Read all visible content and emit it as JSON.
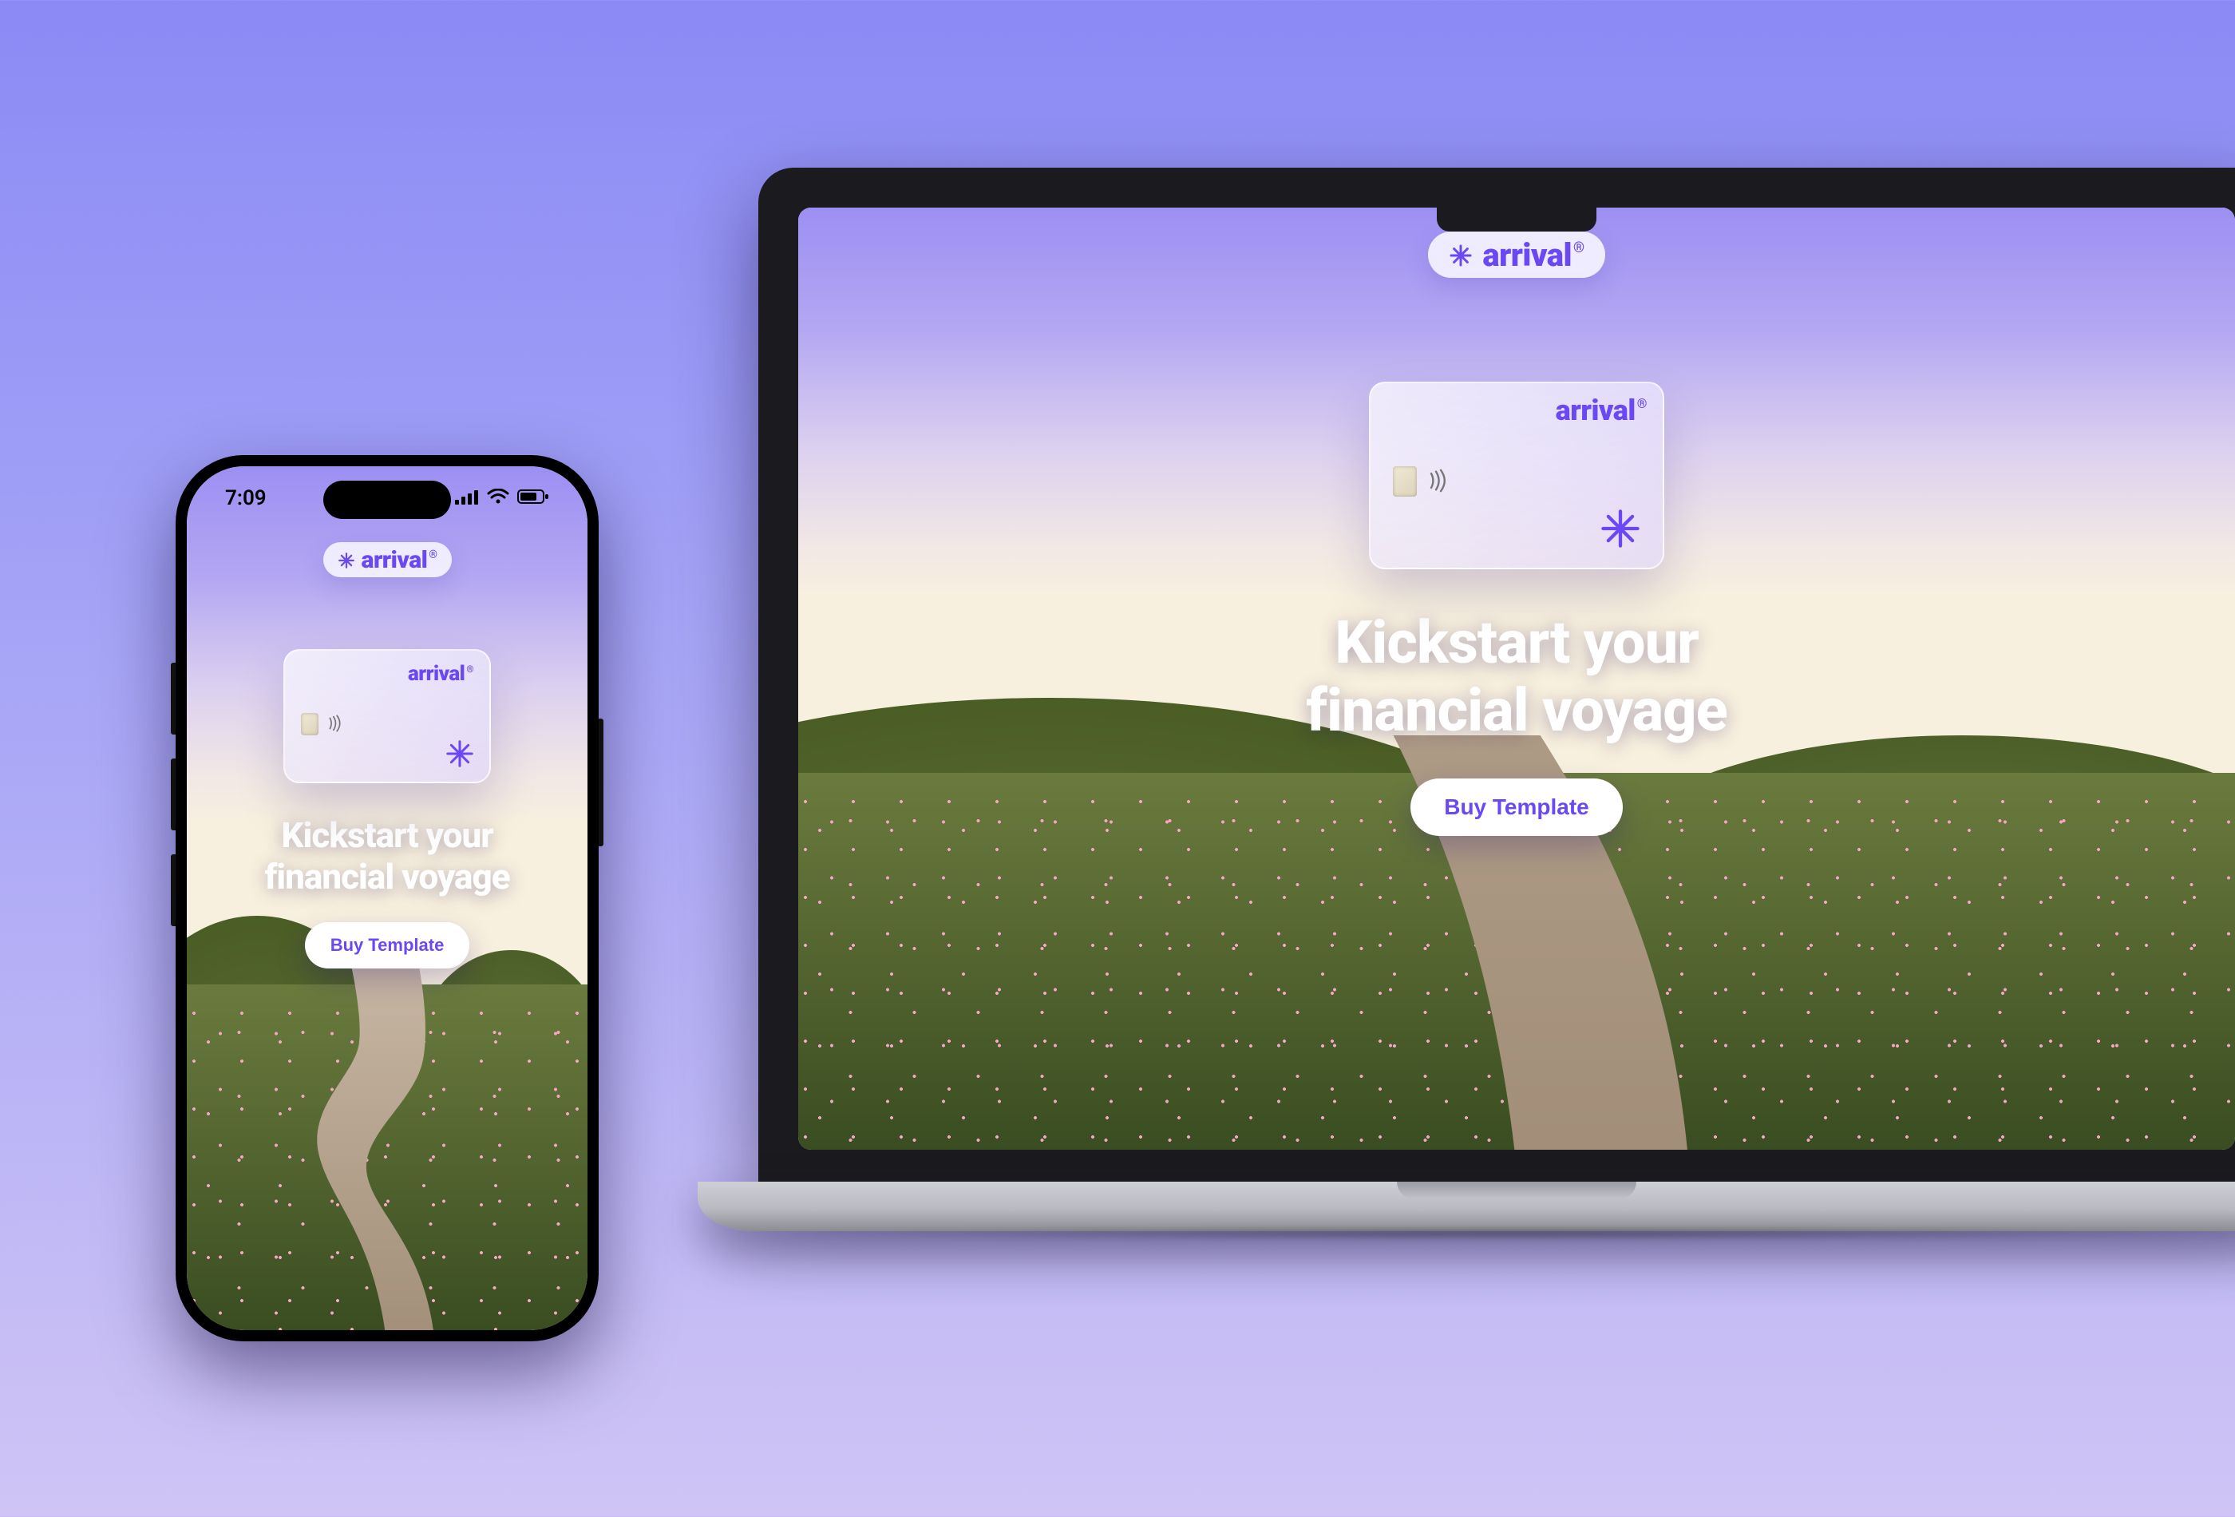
{
  "brand": {
    "name": "arrival",
    "tm": "®"
  },
  "hero": {
    "line1": "Kickstart your",
    "line2": "financial voyage"
  },
  "cta": {
    "label": "Buy Template"
  },
  "phone_status": {
    "time": "7:09"
  },
  "colors": {
    "accent": "#6a49f4"
  }
}
